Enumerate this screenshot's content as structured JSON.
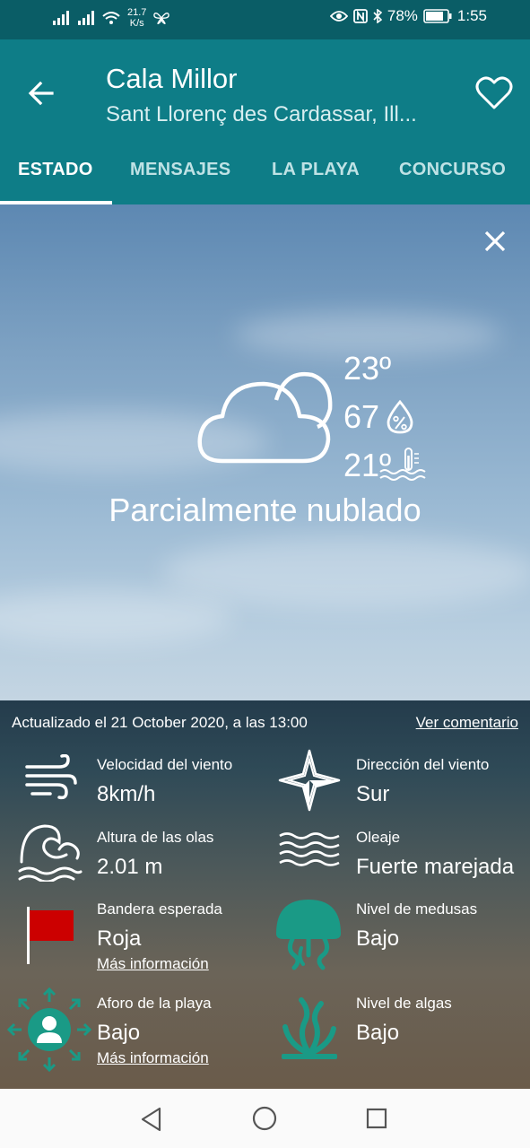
{
  "status_bar": {
    "network_speed_value": "21.7",
    "network_speed_unit": "K/s",
    "battery": "78%",
    "time": "1:55"
  },
  "header": {
    "title": "Cala Millor",
    "subtitle": "Sant Llorenç des Cardassar, Ill..."
  },
  "tabs": [
    {
      "label": "ESTADO",
      "active": true
    },
    {
      "label": "MENSAJES",
      "active": false
    },
    {
      "label": "LA PLAYA",
      "active": false
    },
    {
      "label": "CONCURSO",
      "active": false
    }
  ],
  "weather": {
    "temperature": "23º",
    "humidity": "67",
    "water_temperature": "21º",
    "description": "Parcialmente nublado",
    "icon": "partly-cloudy-icon"
  },
  "info": {
    "updated": "Actualizado el 21 October 2020, a las 13:00",
    "comment_link": "Ver comentario",
    "items": [
      {
        "label": "Velocidad del viento",
        "value": "8km/h",
        "icon": "wind-icon"
      },
      {
        "label": "Dirección del viento",
        "value": "Sur",
        "icon": "compass-rose-icon"
      },
      {
        "label": "Altura de las olas",
        "value": "2.01 m",
        "icon": "wave-icon"
      },
      {
        "label": "Oleaje",
        "value": "Fuerte marejada",
        "icon": "swell-icon"
      },
      {
        "label": "Bandera esperada",
        "value": "Roja",
        "more": "Más información",
        "icon": "red-flag-icon"
      },
      {
        "label": "Nivel de medusas",
        "value": "Bajo",
        "icon": "jellyfish-icon"
      },
      {
        "label": "Aforo de la playa",
        "value": "Bajo",
        "more": "Más información",
        "icon": "beach-capacity-icon"
      },
      {
        "label": "Nivel de algas",
        "value": "Bajo",
        "icon": "seaweed-icon"
      }
    ]
  },
  "colors": {
    "header_bg": "#0e7d87",
    "status_bg": "#0a5d66",
    "accent_icon": "#1a9a86",
    "flag_red": "#cc0000"
  }
}
